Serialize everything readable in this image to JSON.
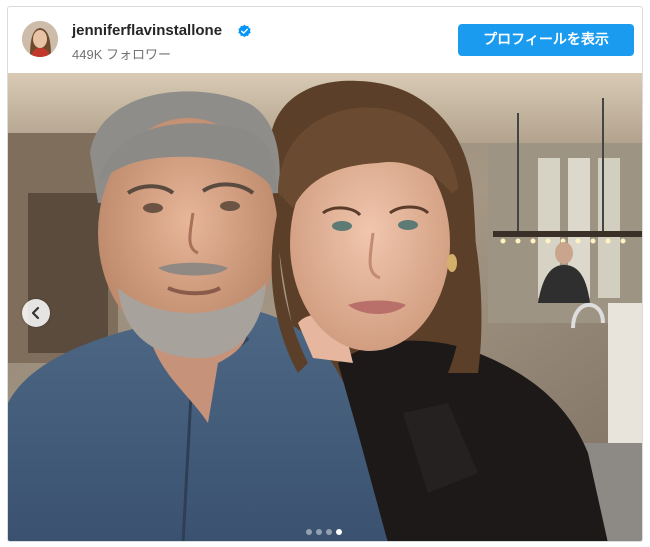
{
  "post": {
    "username": "jenniferflavinstallone",
    "followers": "449K フォロワー",
    "profile_button": "プロフィールを表示"
  },
  "carousel": {
    "total_slides": 4,
    "active_slide": 4
  },
  "colors": {
    "button": "#1a9bf0",
    "verified": "#0095f6"
  },
  "icons": {
    "verified": "verified-badge-icon",
    "previous": "chevron-left-icon"
  }
}
